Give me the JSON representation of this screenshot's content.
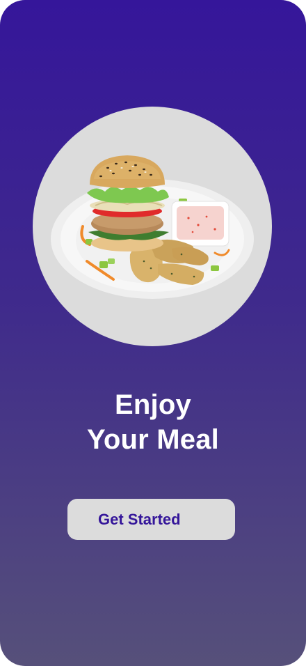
{
  "hero": {
    "image_name": "burger-plate-illustration"
  },
  "headline": {
    "line1": "Enjoy",
    "line2": "Your Meal"
  },
  "cta": {
    "label": "Get Started"
  },
  "colors": {
    "gradient_top": "#35169a",
    "gradient_bottom": "#56507a",
    "button_bg": "#dcdcdc",
    "button_text": "#35169a",
    "circle_bg": "#dcdcdc"
  }
}
